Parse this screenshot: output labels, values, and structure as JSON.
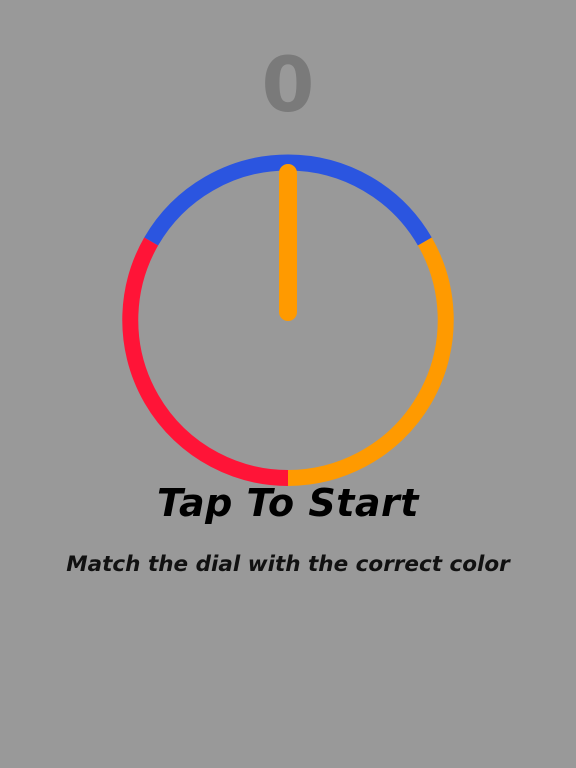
{
  "game": {
    "score": "0",
    "tap_label": "Tap To Start",
    "hint_text": "Match the dial with the correct color"
  },
  "dial": {
    "segments": [
      {
        "name": "blue",
        "color": "#2b55e0"
      },
      {
        "name": "orange",
        "color": "#ff9a00"
      },
      {
        "name": "red",
        "color": "#ff1437"
      }
    ],
    "needle_color": "#ff9a00",
    "background": "#999999"
  }
}
